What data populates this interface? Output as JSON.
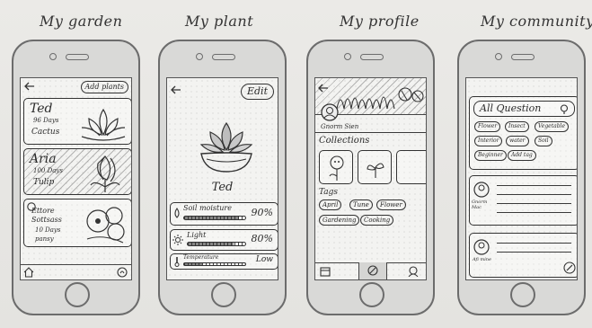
{
  "screens": {
    "garden": {
      "title": "My garden",
      "add_button": "Add plants",
      "plants": [
        {
          "name": "Ted",
          "days": "96 Days",
          "species": "Cactus"
        },
        {
          "name": "Aria",
          "days": "100 Days",
          "species": "Tulip"
        },
        {
          "name": "Ettore Sottsass",
          "days": "10 Days",
          "species": "pansy"
        }
      ]
    },
    "plant": {
      "title": "My plant",
      "edit_button": "Edit",
      "plant_name": "Ted",
      "metrics": [
        {
          "label": "Soil moisture",
          "value": "90%",
          "level": 0.9
        },
        {
          "label": "Light",
          "value": "80%",
          "level": 0.8
        },
        {
          "label": "Temperature",
          "value": "Low",
          "level": 0.3
        }
      ]
    },
    "profile": {
      "title": "My profile",
      "username": "Gnorm Sien",
      "collections_heading": "Collections",
      "tags_heading": "Tags",
      "tags": [
        "April",
        "Tune",
        "Flower",
        "Gardening",
        "Cooking"
      ]
    },
    "community": {
      "title": "My community",
      "question_heading": "All Question",
      "tags": [
        "Flower",
        "Insect",
        "Vegetable",
        "Interior",
        "water",
        "Soil",
        "Beginner",
        "Add tag"
      ],
      "posts": [
        {
          "author": "Gnorm Mac"
        },
        {
          "author": "Afi mine"
        }
      ]
    }
  }
}
